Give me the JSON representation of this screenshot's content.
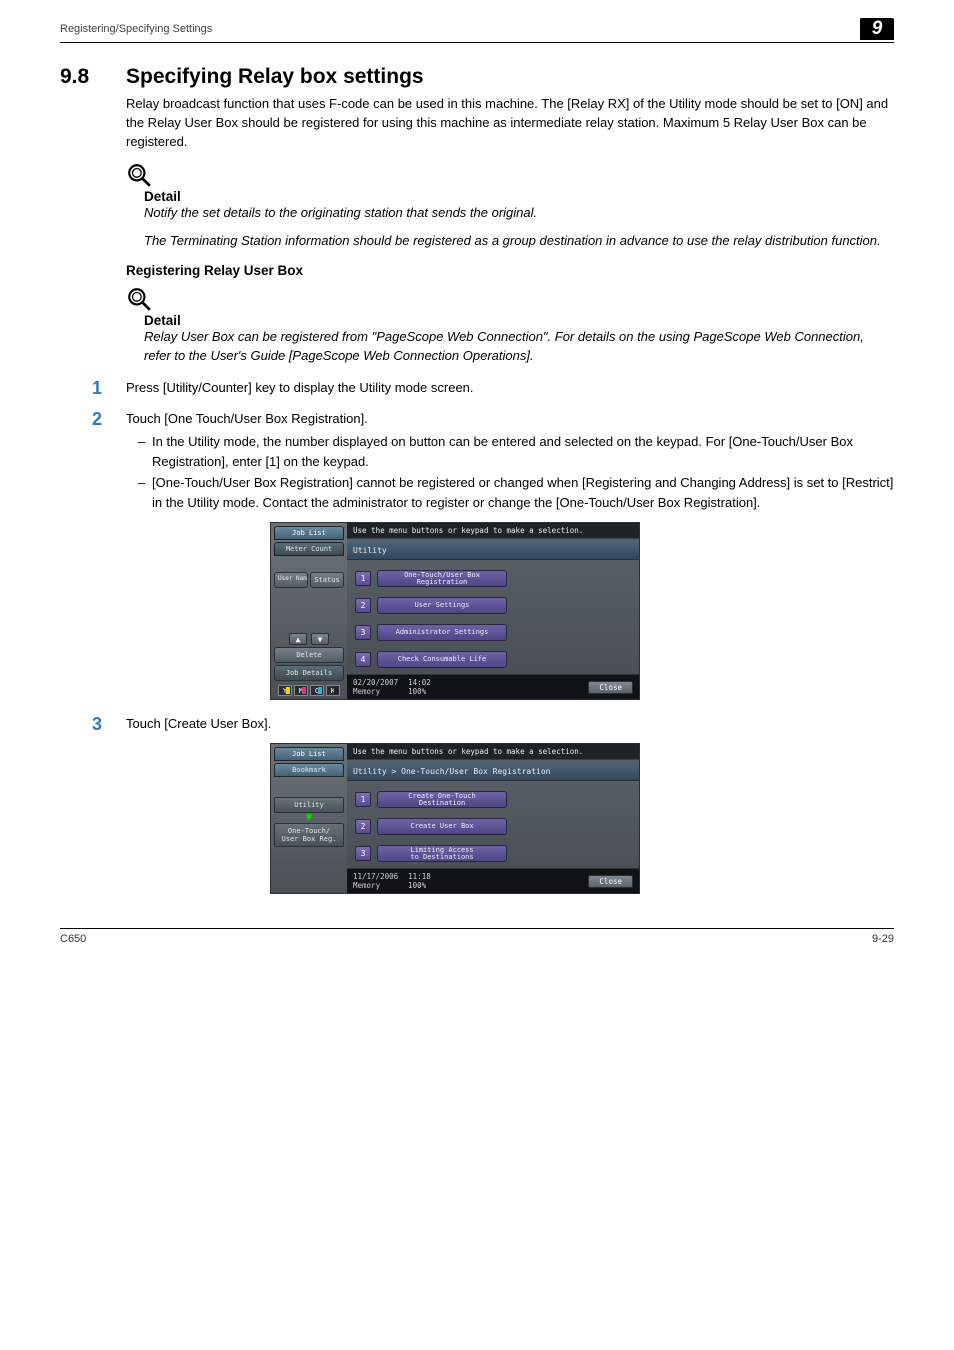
{
  "header": {
    "running_title": "Registering/Specifying Settings",
    "chapter_badge": "9"
  },
  "section": {
    "number": "9.8",
    "title": "Specifying Relay box settings",
    "intro": "Relay broadcast function that uses F-code can be used in this machine. The [Relay RX] of the Utility mode should be set to [ON] and the Relay User Box should be registered for using this machine as intermediate relay station. Maximum 5 Relay User Box can be registered."
  },
  "detail1": {
    "heading": "Detail",
    "p1": "Notify the set details to the originating station that sends the original.",
    "p2": "The Terminating Station information should be registered as a group destination in advance to use the relay distribution function."
  },
  "subheading1": "Registering Relay User Box",
  "detail2": {
    "heading": "Detail",
    "p1": "Relay User Box can be registered from \"PageScope Web Connection\". For details on the using PageScope Web Connection, refer to the User's Guide [PageScope Web Connection Operations]."
  },
  "steps": {
    "s1": {
      "num": "1",
      "text": "Press [Utility/Counter] key to display the Utility mode screen."
    },
    "s2": {
      "num": "2",
      "text": "Touch [One Touch/User Box Registration].",
      "b1": "In the Utility mode, the number displayed on button can be entered and selected on the keypad. For [One-Touch/User Box Registration], enter [1] on the keypad.",
      "b2": "[One-Touch/User Box Registration] cannot be registered or changed when [Registering and Changing Address] is set to [Restrict] in the Utility mode. Contact the administrator to register or change the [One-Touch/User Box Registration]."
    },
    "s3": {
      "num": "3",
      "text": "Touch [Create User Box]."
    }
  },
  "screen1": {
    "sidebar": {
      "job_list": "Job List",
      "meter_count": "Meter Count",
      "user_name": "User\nName",
      "status": "Status",
      "delete": "Delete",
      "job_details": "Job Details",
      "toners": {
        "y": "Y",
        "m": "M",
        "c": "C",
        "k": "K"
      }
    },
    "instruction": "Use the menu buttons or keypad to make a selection.",
    "breadcrumb": "Utility",
    "items": [
      {
        "n": "1",
        "label": "One-Touch/User Box\nRegistration"
      },
      {
        "n": "2",
        "label": "User Settings"
      },
      {
        "n": "3",
        "label": "Administrator Settings"
      },
      {
        "n": "4",
        "label": "Check Consumable Life"
      }
    ],
    "status": {
      "date": "02/20/2007",
      "time": "14:02",
      "mem_label": "Memory",
      "mem_val": "100%",
      "close": "Close"
    }
  },
  "screen2": {
    "sidebar": {
      "job_list": "Job List",
      "bookmark": "Bookmark",
      "utility": "Utility",
      "one_touch": "One-Touch/\nUser Box Reg."
    },
    "instruction": "Use the menu buttons or keypad to make a selection.",
    "breadcrumb": "Utility > One-Touch/User Box Registration",
    "items": [
      {
        "n": "1",
        "label": "Create One-Touch\nDestination"
      },
      {
        "n": "2",
        "label": "Create User Box"
      },
      {
        "n": "3",
        "label": "Limiting Access\nto Destinations"
      }
    ],
    "status": {
      "date": "11/17/2006",
      "time": "11:18",
      "mem_label": "Memory",
      "mem_val": "100%",
      "close": "Close"
    }
  },
  "footer": {
    "model": "C650",
    "page": "9-29"
  }
}
